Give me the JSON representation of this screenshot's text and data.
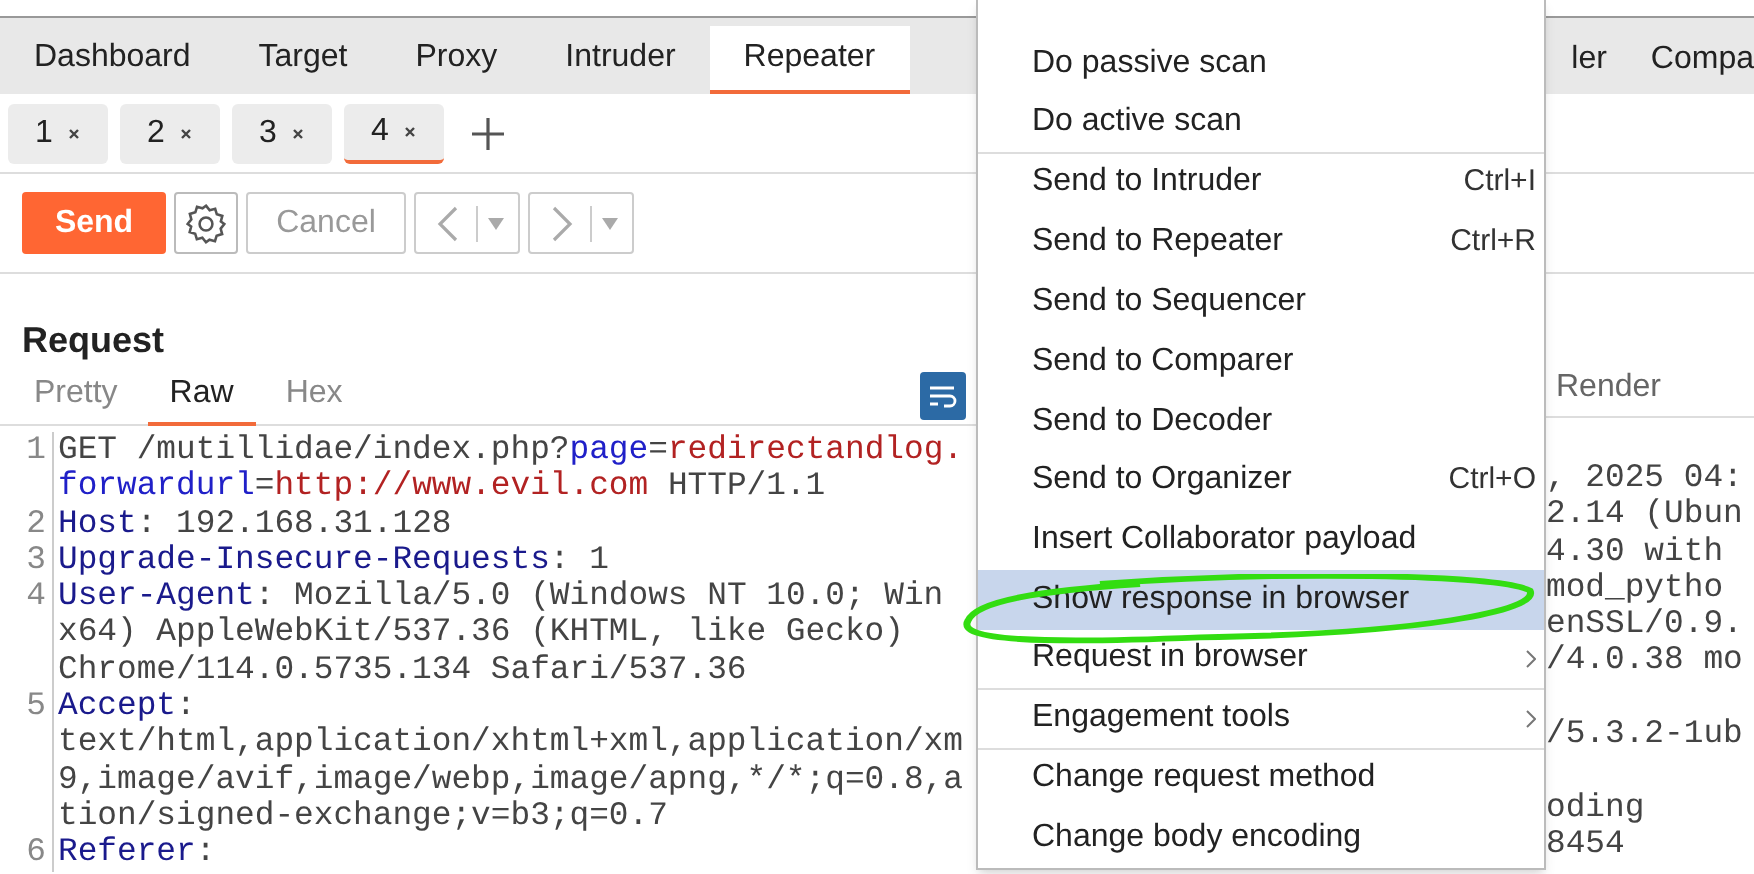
{
  "main_tabs": [
    {
      "label": "Dashboard",
      "selected": false
    },
    {
      "label": "Target",
      "selected": false
    },
    {
      "label": "Proxy",
      "selected": false
    },
    {
      "label": "Intruder",
      "selected": false
    },
    {
      "label": "Repeater",
      "selected": true
    }
  ],
  "main_tabs_right": [
    "ler",
    "Compa"
  ],
  "repeater_tabs": [
    {
      "label": "1",
      "selected": false
    },
    {
      "label": "2",
      "selected": false
    },
    {
      "label": "3",
      "selected": false
    },
    {
      "label": "4",
      "selected": true
    }
  ],
  "toolbar": {
    "send": "Send",
    "cancel": "Cancel"
  },
  "request": {
    "title": "Request",
    "tabs": [
      {
        "label": "Pretty",
        "selected": false
      },
      {
        "label": "Raw",
        "selected": true
      },
      {
        "label": "Hex",
        "selected": false
      }
    ],
    "lines": [
      {
        "number": "1",
        "rows": [
          {
            "segments": [
              {
                "text": "GET /mutillidae/index.php?",
                "kind": "plain"
              },
              {
                "text": "page",
                "kind": "param"
              },
              {
                "text": "=",
                "kind": "plain"
              },
              {
                "text": "redirectandlog.",
                "kind": "value"
              }
            ]
          },
          {
            "segments": [
              {
                "text": "forwardurl",
                "kind": "param"
              },
              {
                "text": "=",
                "kind": "plain"
              },
              {
                "text": "http://www.evil.com",
                "kind": "value"
              },
              {
                "text": " HTTP/1.1",
                "kind": "plain"
              }
            ]
          }
        ]
      },
      {
        "number": "2",
        "rows": [
          {
            "segments": [
              {
                "text": "Host",
                "kind": "header"
              },
              {
                "text": ": 192.168.31.128",
                "kind": "plain"
              }
            ]
          }
        ]
      },
      {
        "number": "3",
        "rows": [
          {
            "segments": [
              {
                "text": "Upgrade-Insecure-Requests",
                "kind": "header"
              },
              {
                "text": ": 1",
                "kind": "plain"
              }
            ]
          }
        ]
      },
      {
        "number": "4",
        "rows": [
          {
            "segments": [
              {
                "text": "User-Agent",
                "kind": "header"
              },
              {
                "text": ": Mozilla/5.0 (Windows NT 10.0; Win",
                "kind": "plain"
              }
            ]
          },
          {
            "segments": [
              {
                "text": "x64) AppleWebKit/537.36 (KHTML, like Gecko)",
                "kind": "plain"
              }
            ]
          },
          {
            "segments": [
              {
                "text": "Chrome/114.0.5735.134 Safari/537.36",
                "kind": "plain"
              }
            ]
          }
        ]
      },
      {
        "number": "5",
        "rows": [
          {
            "segments": [
              {
                "text": "Accept",
                "kind": "header"
              },
              {
                "text": ":",
                "kind": "plain"
              }
            ]
          },
          {
            "segments": [
              {
                "text": "text/html,application/xhtml+xml,application/xm",
                "kind": "plain"
              }
            ]
          },
          {
            "segments": [
              {
                "text": "9,image/avif,image/webp,image/apng,*/*;q=0.8,a",
                "kind": "plain"
              }
            ]
          },
          {
            "segments": [
              {
                "text": "tion/signed-exchange;v=b3;q=0.7",
                "kind": "plain"
              }
            ]
          }
        ]
      },
      {
        "number": "6",
        "rows": [
          {
            "segments": [
              {
                "text": "Referer",
                "kind": "header"
              },
              {
                "text": ":",
                "kind": "plain"
              }
            ]
          }
        ]
      }
    ]
  },
  "response": {
    "tab": "Render",
    "rows": [
      {
        "text": ", 2025 04:",
        "blank_before": false
      },
      {
        "text": "2.14 (Ubun",
        "blank_before": false
      },
      {
        "text": "4.30 with",
        "blank_before": false
      },
      {
        "text": "mod_pytho",
        "blank_before": false
      },
      {
        "text": "enSSL/0.9.",
        "blank_before": false
      },
      {
        "text": "/4.0.38 mo",
        "blank_before": false
      },
      {
        "text": "/5.3.2-1ub",
        "blank_before": true
      },
      {
        "text": "oding",
        "blank_before": true
      },
      {
        "text": "8454",
        "blank_before": false
      }
    ]
  },
  "context_menu": [
    {
      "label": "Do passive scan",
      "submenu": false,
      "selected": false,
      "separator_after": false
    },
    {
      "label": "Do active scan",
      "submenu": false,
      "selected": false,
      "separator_after": true
    },
    {
      "label": "Send to Intruder",
      "shortcut": "Ctrl+I",
      "submenu": false,
      "selected": false,
      "separator_after": false
    },
    {
      "label": "Send to Repeater",
      "shortcut": "Ctrl+R",
      "submenu": false,
      "selected": false,
      "separator_after": false
    },
    {
      "label": "Send to Sequencer",
      "submenu": false,
      "selected": false,
      "separator_after": false
    },
    {
      "label": "Send to Comparer",
      "submenu": false,
      "selected": false,
      "separator_after": false
    },
    {
      "label": "Send to Decoder",
      "submenu": false,
      "selected": false,
      "separator_after": false
    },
    {
      "label": "Send to Organizer",
      "shortcut": "Ctrl+O",
      "submenu": false,
      "selected": false,
      "separator_after": false
    },
    {
      "label": "Insert Collaborator payload",
      "submenu": false,
      "selected": false,
      "separator_after": false
    },
    {
      "label": "Show response in browser",
      "submenu": false,
      "selected": true,
      "separator_after": false
    },
    {
      "label": "Request in browser",
      "submenu": true,
      "selected": false,
      "separator_after": true
    },
    {
      "label": "Engagement tools",
      "submenu": true,
      "selected": false,
      "separator_after": true
    },
    {
      "label": "Change request method",
      "submenu": false,
      "selected": false,
      "separator_after": false
    },
    {
      "label": "Change body encoding",
      "submenu": false,
      "selected": false,
      "separator_after": false
    }
  ]
}
